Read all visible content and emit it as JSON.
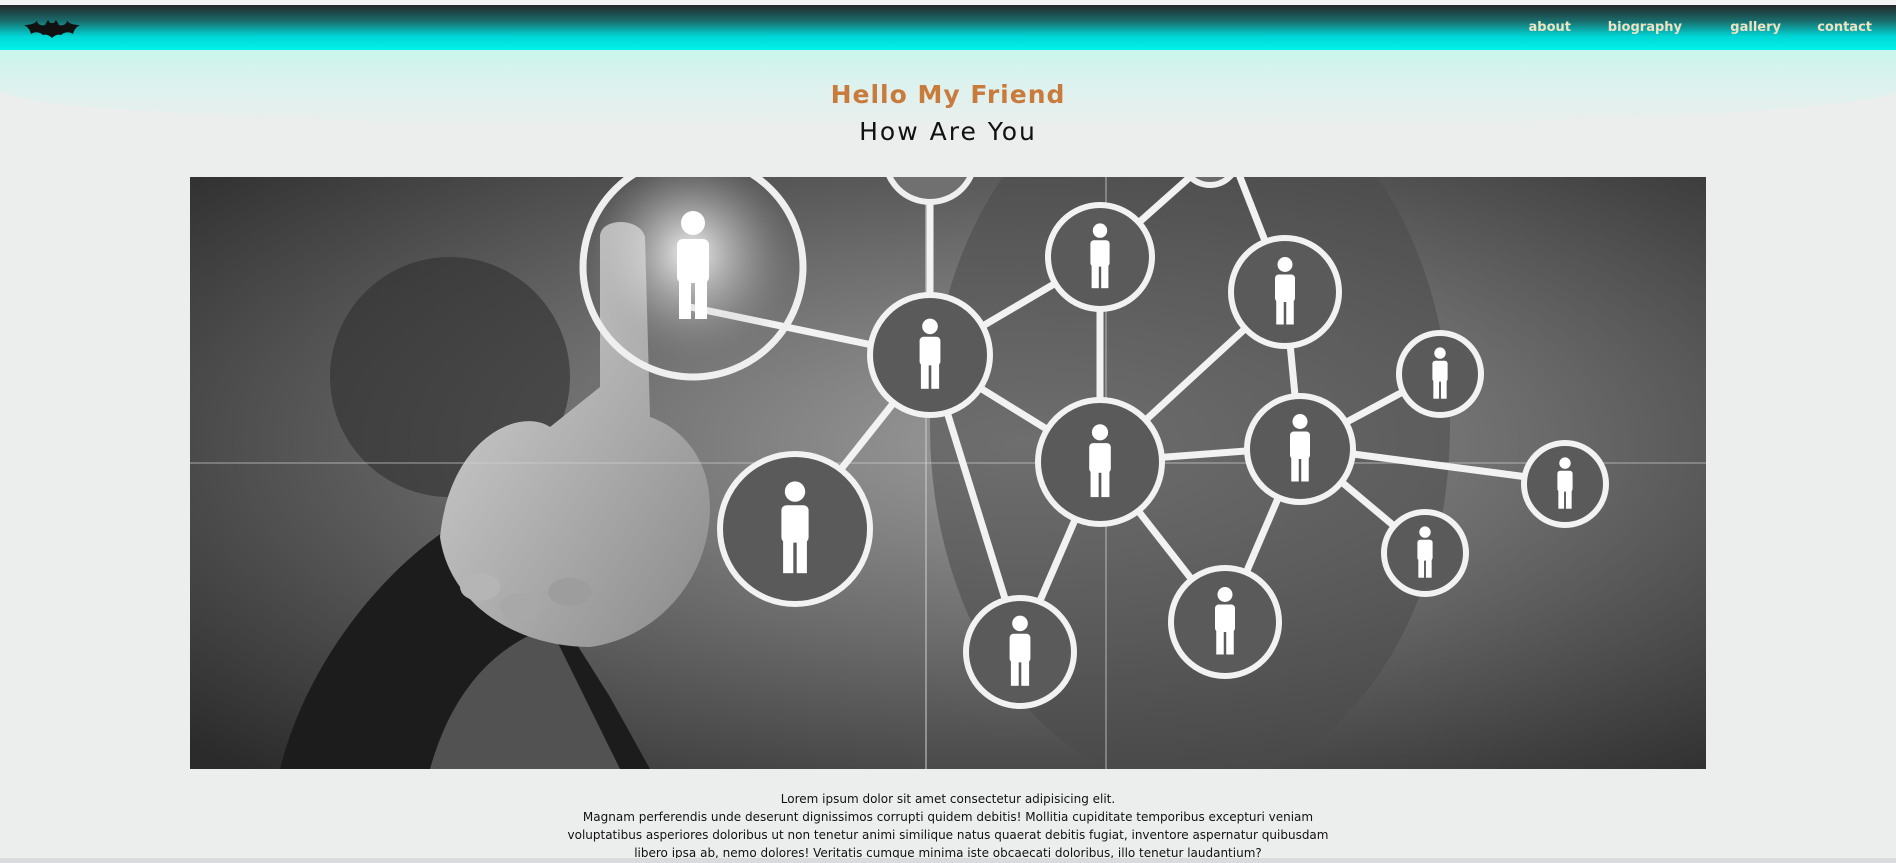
{
  "colors": {
    "accent_title": "#c97b3c",
    "nav_text": "#f1e2c2",
    "nav_gradient_top": "#242828",
    "nav_gradient_bottom": "#00f3ea",
    "page_background": "#eceeed"
  },
  "header": {
    "logo_icon": "bat-logo-icon",
    "nav": [
      {
        "label": "about"
      },
      {
        "label": "biography"
      },
      {
        "label": "gallery"
      },
      {
        "label": "contact"
      }
    ]
  },
  "hero": {
    "title": "Hello My Friend",
    "subtitle": "How Are You",
    "image_icon": "social-network-people-icon"
  },
  "content": {
    "lines": [
      "Lorem ipsum dolor sit amet consectetur adipisicing elit.",
      "Magnam perferendis unde deserunt dignissimos corrupti quidem debitis! Mollitia cupiditate temporibus excepturi veniam",
      "voluptatibus asperiores doloribus ut non tenetur animi similique natus quaerat debitis fugiat, inventore aspernatur quibusdam",
      "libero ipsa ab, nemo dolores! Veritatis cumque minima iste obcaecati doloribus, illo tenetur laudantium?"
    ]
  }
}
